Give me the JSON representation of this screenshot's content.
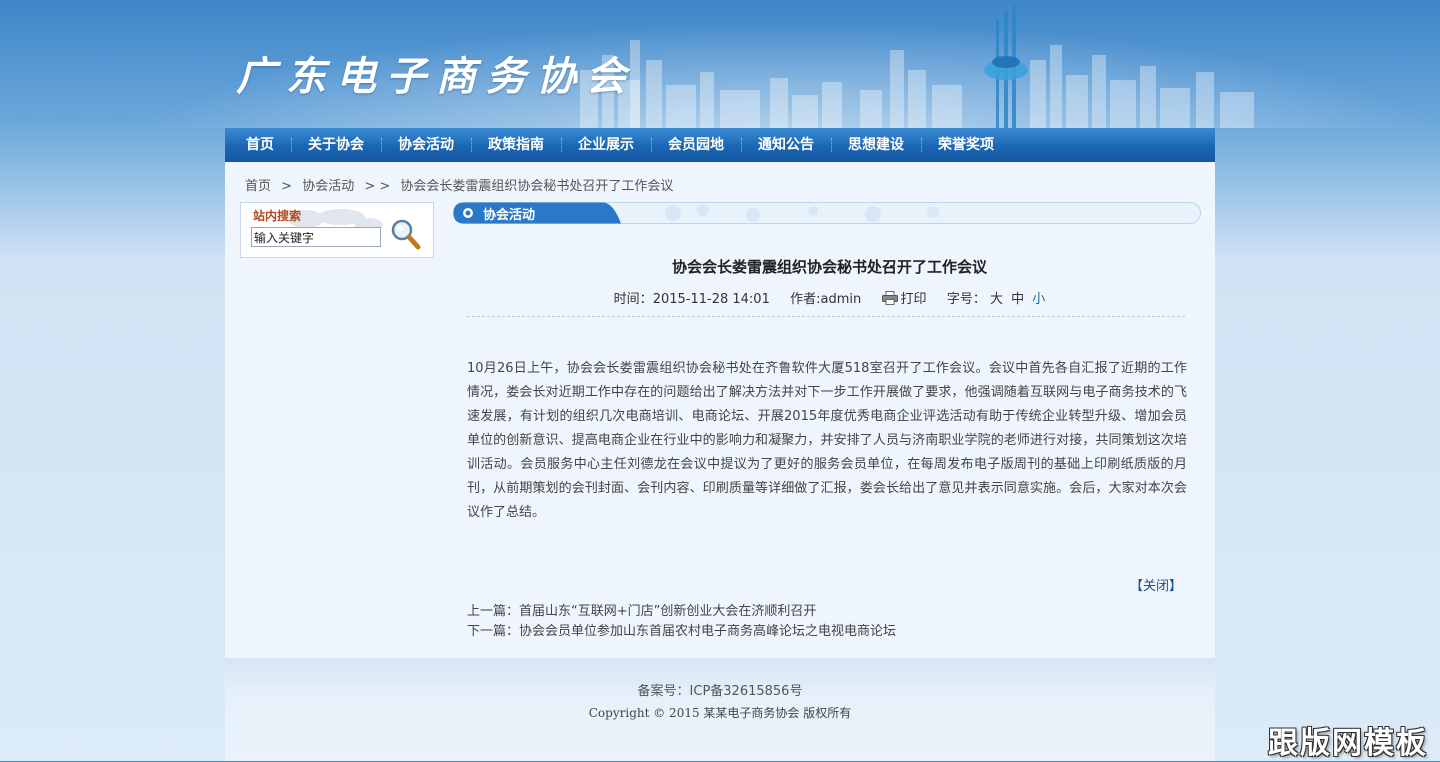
{
  "header": {
    "site_title": "广东电子商务协会"
  },
  "nav": {
    "items": [
      "首页",
      "关于协会",
      "协会活动",
      "政策指南",
      "企业展示",
      "会员园地",
      "通知公告",
      "思想建设",
      "荣誉奖项"
    ]
  },
  "breadcrumb": {
    "home": "首页",
    "sep1": ">",
    "category": "协会活动",
    "sep2": "> >",
    "current": "协会会长娄雷震组织协会秘书处召开了工作会议"
  },
  "search": {
    "title": "站内搜索",
    "input_value": "输入关键字"
  },
  "section": {
    "title": "协会活动"
  },
  "article": {
    "title": "协会会长娄雷震组织协会秘书处召开了工作会议",
    "time_label": "时间：",
    "time_value": "2015-11-28 14:01",
    "author_label": "作者:",
    "author_value": "admin",
    "print_label": "打印",
    "font_size_label": "字号：",
    "font_large": "大",
    "font_medium": "中",
    "font_small": "小",
    "body": "10月26日上午，协会会长娄雷震组织协会秘书处在齐鲁软件大厦518室召开了工作会议。会议中首先各自汇报了近期的工作情况，娄会长对近期工作中存在的问题给出了解决方法并对下一步工作开展做了要求，他强调随着互联网与电子商务技术的飞速发展，有计划的组织几次电商培训、电商论坛、开展2015年度优秀电商企业评选活动有助于传统企业转型升级、增加会员单位的创新意识、提高电商企业在行业中的影响力和凝聚力，并安排了人员与济南职业学院的老师进行对接，共同策划这次培训活动。会员服务中心主任刘德龙在会议中提议为了更好的服务会员单位，在每周发布电子版周刊的基础上印刷纸质版的月刊，从前期策划的会刊封面、会刊内容、印刷质量等详细做了汇报，娄会长给出了意见并表示同意实施。会后，大家对本次会议作了总结。",
    "close_label": "【关闭】",
    "prev_label": "上一篇：",
    "prev_title": "首届山东“互联网+门店”创新创业大会在济顺利召开",
    "next_label": "下一篇：",
    "next_title": "协会会员单位参加山东首届农村电子商务高峰论坛之电视电商论坛"
  },
  "footer": {
    "icp": "备案号：ICP备32615856号",
    "copyright": "Copyright © 2015 某某电子商务协会 版权所有"
  },
  "watermark": "跟版网模板",
  "colors": {
    "nav_blue": "#1b66b4",
    "panel_bg": "#eef5fc",
    "accent_link": "#1a4f8b"
  }
}
